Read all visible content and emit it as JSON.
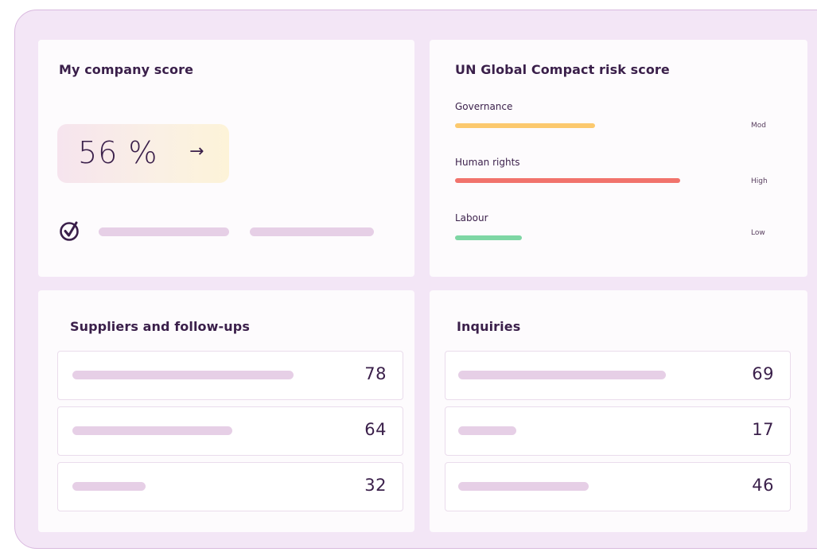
{
  "company_score": {
    "title": "My company score",
    "score": "56 %",
    "arrow": "→"
  },
  "un_risk": {
    "title": "UN Global Compact risk score",
    "rows": [
      {
        "label": "Governance",
        "level": "Mod",
        "value_fraction": 0.46,
        "color": "#fcc96e"
      },
      {
        "label": "Human rights",
        "level": "High",
        "value_fraction": 0.74,
        "color": "#f1736c"
      },
      {
        "label": "Labour",
        "level": "Low",
        "value_fraction": 0.22,
        "color": "#7ed6a4"
      }
    ]
  },
  "suppliers": {
    "title": "Suppliers and follow-ups",
    "rows": [
      {
        "value": "78"
      },
      {
        "value": "64"
      },
      {
        "value": "32"
      }
    ]
  },
  "inquiries": {
    "title": "Inquiries",
    "rows": [
      {
        "value": "69"
      },
      {
        "value": "17"
      },
      {
        "value": "46"
      }
    ]
  },
  "colors": {
    "frame": "#f3e6f6",
    "skeleton": "#e6cfe6",
    "text": "#3a1f4a"
  },
  "icons": {
    "check": "checkmark-circle-icon",
    "arrow": "arrow-right-icon"
  }
}
